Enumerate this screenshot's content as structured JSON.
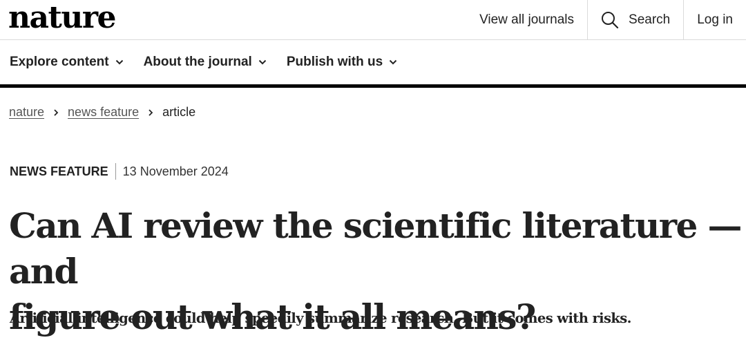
{
  "header": {
    "logo": "nature",
    "links": {
      "journals": "View all journals",
      "search": "Search",
      "login": "Log in"
    }
  },
  "nav": {
    "explore": "Explore content",
    "about": "About the journal",
    "publish": "Publish with us"
  },
  "breadcrumb": {
    "home": "nature",
    "section": "news feature",
    "current": "article"
  },
  "article": {
    "type": "NEWS FEATURE",
    "date": "13 November 2024",
    "title_line1": "Can AI review the scientific literature — and",
    "title_line2": "figure out what it all means?",
    "standfirst": "Artificial intelligence could help speedily summarize research. But it comes with risks."
  },
  "icons": {
    "search": "search-icon",
    "chevron": "chevron-down-icon",
    "separator": "chevron-right-icon"
  }
}
